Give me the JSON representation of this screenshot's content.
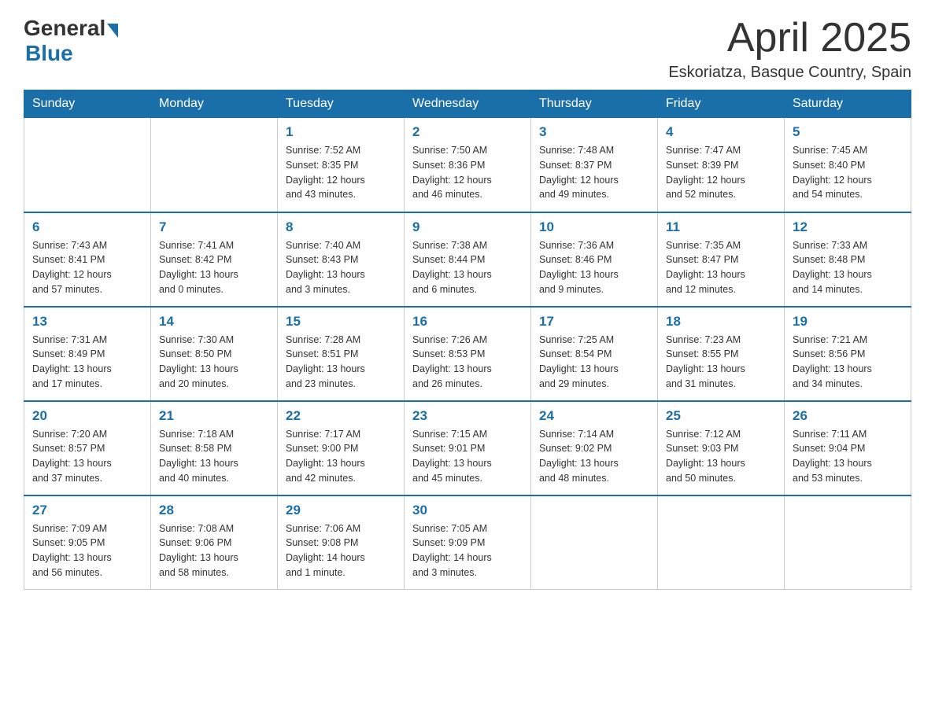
{
  "header": {
    "logo": {
      "text_general": "General",
      "arrow": "▶",
      "text_blue": "Blue"
    },
    "title": "April 2025",
    "location": "Eskoriatza, Basque Country, Spain"
  },
  "weekdays": [
    "Sunday",
    "Monday",
    "Tuesday",
    "Wednesday",
    "Thursday",
    "Friday",
    "Saturday"
  ],
  "weeks": [
    [
      {
        "day": "",
        "info": ""
      },
      {
        "day": "",
        "info": ""
      },
      {
        "day": "1",
        "info": "Sunrise: 7:52 AM\nSunset: 8:35 PM\nDaylight: 12 hours\nand 43 minutes."
      },
      {
        "day": "2",
        "info": "Sunrise: 7:50 AM\nSunset: 8:36 PM\nDaylight: 12 hours\nand 46 minutes."
      },
      {
        "day": "3",
        "info": "Sunrise: 7:48 AM\nSunset: 8:37 PM\nDaylight: 12 hours\nand 49 minutes."
      },
      {
        "day": "4",
        "info": "Sunrise: 7:47 AM\nSunset: 8:39 PM\nDaylight: 12 hours\nand 52 minutes."
      },
      {
        "day": "5",
        "info": "Sunrise: 7:45 AM\nSunset: 8:40 PM\nDaylight: 12 hours\nand 54 minutes."
      }
    ],
    [
      {
        "day": "6",
        "info": "Sunrise: 7:43 AM\nSunset: 8:41 PM\nDaylight: 12 hours\nand 57 minutes."
      },
      {
        "day": "7",
        "info": "Sunrise: 7:41 AM\nSunset: 8:42 PM\nDaylight: 13 hours\nand 0 minutes."
      },
      {
        "day": "8",
        "info": "Sunrise: 7:40 AM\nSunset: 8:43 PM\nDaylight: 13 hours\nand 3 minutes."
      },
      {
        "day": "9",
        "info": "Sunrise: 7:38 AM\nSunset: 8:44 PM\nDaylight: 13 hours\nand 6 minutes."
      },
      {
        "day": "10",
        "info": "Sunrise: 7:36 AM\nSunset: 8:46 PM\nDaylight: 13 hours\nand 9 minutes."
      },
      {
        "day": "11",
        "info": "Sunrise: 7:35 AM\nSunset: 8:47 PM\nDaylight: 13 hours\nand 12 minutes."
      },
      {
        "day": "12",
        "info": "Sunrise: 7:33 AM\nSunset: 8:48 PM\nDaylight: 13 hours\nand 14 minutes."
      }
    ],
    [
      {
        "day": "13",
        "info": "Sunrise: 7:31 AM\nSunset: 8:49 PM\nDaylight: 13 hours\nand 17 minutes."
      },
      {
        "day": "14",
        "info": "Sunrise: 7:30 AM\nSunset: 8:50 PM\nDaylight: 13 hours\nand 20 minutes."
      },
      {
        "day": "15",
        "info": "Sunrise: 7:28 AM\nSunset: 8:51 PM\nDaylight: 13 hours\nand 23 minutes."
      },
      {
        "day": "16",
        "info": "Sunrise: 7:26 AM\nSunset: 8:53 PM\nDaylight: 13 hours\nand 26 minutes."
      },
      {
        "day": "17",
        "info": "Sunrise: 7:25 AM\nSunset: 8:54 PM\nDaylight: 13 hours\nand 29 minutes."
      },
      {
        "day": "18",
        "info": "Sunrise: 7:23 AM\nSunset: 8:55 PM\nDaylight: 13 hours\nand 31 minutes."
      },
      {
        "day": "19",
        "info": "Sunrise: 7:21 AM\nSunset: 8:56 PM\nDaylight: 13 hours\nand 34 minutes."
      }
    ],
    [
      {
        "day": "20",
        "info": "Sunrise: 7:20 AM\nSunset: 8:57 PM\nDaylight: 13 hours\nand 37 minutes."
      },
      {
        "day": "21",
        "info": "Sunrise: 7:18 AM\nSunset: 8:58 PM\nDaylight: 13 hours\nand 40 minutes."
      },
      {
        "day": "22",
        "info": "Sunrise: 7:17 AM\nSunset: 9:00 PM\nDaylight: 13 hours\nand 42 minutes."
      },
      {
        "day": "23",
        "info": "Sunrise: 7:15 AM\nSunset: 9:01 PM\nDaylight: 13 hours\nand 45 minutes."
      },
      {
        "day": "24",
        "info": "Sunrise: 7:14 AM\nSunset: 9:02 PM\nDaylight: 13 hours\nand 48 minutes."
      },
      {
        "day": "25",
        "info": "Sunrise: 7:12 AM\nSunset: 9:03 PM\nDaylight: 13 hours\nand 50 minutes."
      },
      {
        "day": "26",
        "info": "Sunrise: 7:11 AM\nSunset: 9:04 PM\nDaylight: 13 hours\nand 53 minutes."
      }
    ],
    [
      {
        "day": "27",
        "info": "Sunrise: 7:09 AM\nSunset: 9:05 PM\nDaylight: 13 hours\nand 56 minutes."
      },
      {
        "day": "28",
        "info": "Sunrise: 7:08 AM\nSunset: 9:06 PM\nDaylight: 13 hours\nand 58 minutes."
      },
      {
        "day": "29",
        "info": "Sunrise: 7:06 AM\nSunset: 9:08 PM\nDaylight: 14 hours\nand 1 minute."
      },
      {
        "day": "30",
        "info": "Sunrise: 7:05 AM\nSunset: 9:09 PM\nDaylight: 14 hours\nand 3 minutes."
      },
      {
        "day": "",
        "info": ""
      },
      {
        "day": "",
        "info": ""
      },
      {
        "day": "",
        "info": ""
      }
    ]
  ]
}
